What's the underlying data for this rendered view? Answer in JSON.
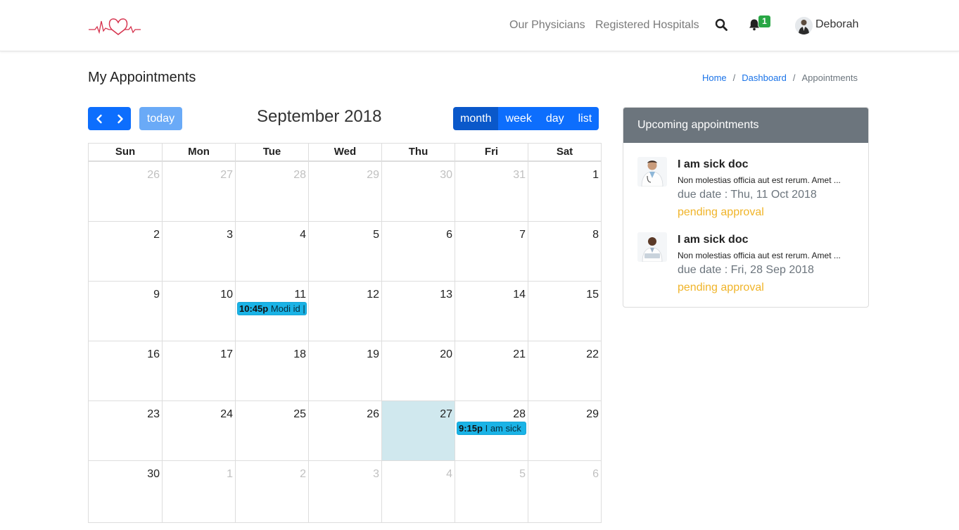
{
  "nav": {
    "links": [
      "Our Physicians",
      "Registered Hospitals"
    ],
    "notification_count": "1",
    "user_name": "Deborah"
  },
  "page": {
    "title": "My Appointments",
    "breadcrumb": [
      "Home",
      "Dashboard",
      "Appointments"
    ]
  },
  "calendar": {
    "today_label": "today",
    "title": "September 2018",
    "views": [
      "month",
      "week",
      "day",
      "list"
    ],
    "active_view": "month",
    "weekdays": [
      "Sun",
      "Mon",
      "Tue",
      "Wed",
      "Thu",
      "Fri",
      "Sat"
    ],
    "weeks": [
      [
        "26",
        "27",
        "28",
        "29",
        "30",
        "31",
        "1"
      ],
      [
        "2",
        "3",
        "4",
        "5",
        "6",
        "7",
        "8"
      ],
      [
        "9",
        "10",
        "11",
        "12",
        "13",
        "14",
        "15"
      ],
      [
        "16",
        "17",
        "18",
        "19",
        "20",
        "21",
        "22"
      ],
      [
        "23",
        "24",
        "25",
        "26",
        "27",
        "28",
        "29"
      ],
      [
        "30",
        "1",
        "2",
        "3",
        "4",
        "5",
        "6"
      ]
    ],
    "events": [
      {
        "time": "10:45p",
        "title": "Modi id |"
      },
      {
        "time": "9:15p",
        "title": "I am sick"
      }
    ]
  },
  "upcoming": {
    "header": "Upcoming appointments",
    "items": [
      {
        "title": "I am sick doc",
        "description": "Non molestias officia aut est rerum. Amet ...",
        "due": "due date : Thu, 11 Oct 2018",
        "status": "pending approval"
      },
      {
        "title": "I am sick doc",
        "description": "Non molestias officia aut est rerum. Amet ...",
        "due": "due date : Fri, 28 Sep 2018",
        "status": "pending approval"
      }
    ]
  },
  "colors": {
    "primary": "#0d6efd",
    "today_highlight": "#d0e8ee",
    "event": "#1ab3e6",
    "status_pending": "#f0b429",
    "card_header": "#6c757d",
    "logo": "#d6334e",
    "badge": "#28a745"
  },
  "icons": [
    "heartbeat-logo-icon",
    "search-icon",
    "bell-icon",
    "chevron-left-icon",
    "chevron-right-icon",
    "doctor-avatar-icon"
  ]
}
